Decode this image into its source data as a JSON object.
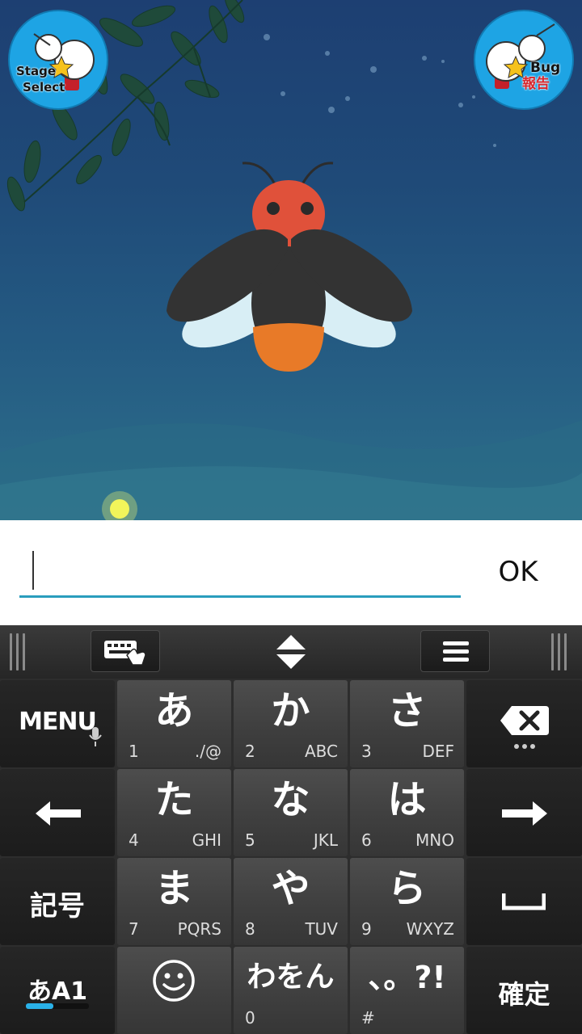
{
  "game": {
    "stage_select": {
      "line1": "Stage",
      "line2": "Select",
      "icon": "mascot-icon"
    },
    "bug_report": {
      "line1": "Bug",
      "line2": "報告",
      "icon": "mascot-icon"
    },
    "character": "firefly",
    "colors": {
      "sky_top": "#1d3f72",
      "sky_bottom": "#2d6f8b",
      "firefly_head": "#e0513a",
      "firefly_tail": "#e87a28"
    }
  },
  "input": {
    "value": "",
    "placeholder": "",
    "ok_label": "OK",
    "accent": "#2a9dbd"
  },
  "keyboard": {
    "toolbar": {
      "left_icon": "keyboard-hand-icon",
      "center_icon": "resize-arrows-icon",
      "right_icon": "hamburger-menu-icon"
    },
    "menu_label": "MENU",
    "symbols_label": "記号",
    "mode_label": "あA1",
    "confirm_label": "確定",
    "keys": [
      {
        "kana": "あ",
        "num": "1",
        "sub": "./@"
      },
      {
        "kana": "か",
        "num": "2",
        "sub": "ABC"
      },
      {
        "kana": "さ",
        "num": "3",
        "sub": "DEF"
      },
      {
        "kana": "た",
        "num": "4",
        "sub": "GHI"
      },
      {
        "kana": "な",
        "num": "5",
        "sub": "JKL"
      },
      {
        "kana": "は",
        "num": "6",
        "sub": "MNO"
      },
      {
        "kana": "ま",
        "num": "7",
        "sub": "PQRS"
      },
      {
        "kana": "や",
        "num": "8",
        "sub": "TUV"
      },
      {
        "kana": "ら",
        "num": "9",
        "sub": "WXYZ"
      },
      {
        "kana": "わをん",
        "num": "0",
        "sub": ""
      },
      {
        "kana": "、。?!",
        "num": "#",
        "sub": ""
      }
    ]
  }
}
